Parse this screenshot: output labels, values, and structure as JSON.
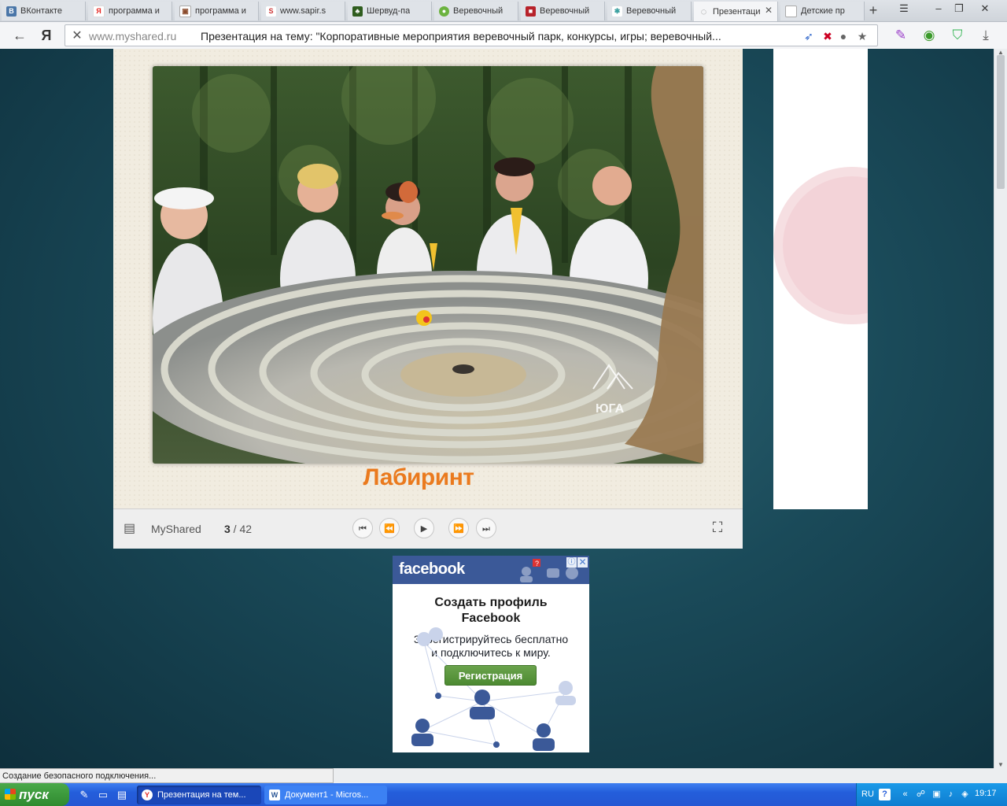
{
  "tabs": [
    {
      "label": "ВКонтакте",
      "icon": "vk-icon",
      "color": "#4a76a8",
      "glyph": "В"
    },
    {
      "label": "программа и",
      "icon": "yandex-icon",
      "color": "#e52620",
      "glyph": "Я"
    },
    {
      "label": "программа и",
      "icon": "image-icon",
      "color": "#8a4a2a",
      "glyph": "▣"
    },
    {
      "label": "www.sapir.s",
      "icon": "sapir-icon",
      "color": "#c33",
      "glyph": "S"
    },
    {
      "label": "Шервуд-па",
      "icon": "sherwood-icon",
      "color": "#2f5d1e",
      "glyph": "♣"
    },
    {
      "label": "Веревочный",
      "icon": "green-circle-icon",
      "color": "#6cb33f",
      "glyph": "●"
    },
    {
      "label": "Веревочный",
      "icon": "red-cube-icon",
      "color": "#b7222a",
      "glyph": "■"
    },
    {
      "label": "Веревочный",
      "icon": "snowflake-icon",
      "color": "#3aa0a0",
      "glyph": "✱"
    },
    {
      "label": "Презентаци",
      "icon": "loading-icon",
      "color": "#999",
      "glyph": "◌",
      "active": true
    },
    {
      "label": "Детские пр",
      "icon": "page-icon",
      "color": "#aaa",
      "glyph": "▯"
    }
  ],
  "address": {
    "domain": "www.myshared.ru",
    "title": "Презентация на тему: \"Корпоративные мероприятия веревочный парк, конкурсы, игры; веревочный..."
  },
  "slide": {
    "title": "Лабиринт",
    "badge_text": "ЮГА"
  },
  "controls": {
    "brand": "MyShared",
    "current_page": "3",
    "separator": " / ",
    "total_pages": "42"
  },
  "fb_ad": {
    "logo": "facebook",
    "headline_line1": "Создать профиль",
    "headline_line2": "Facebook",
    "sub_line1": "Зарегистрируйтесь бесплатно",
    "sub_line2": "и подключитесь к миру.",
    "button": "Регистрация",
    "notif_count": "?"
  },
  "status_text": "Создание безопасного подключения...",
  "taskbar": {
    "start_label": "пуск",
    "tasks": [
      {
        "label": "Презентация на тем...",
        "glyph": "Y",
        "active": true
      },
      {
        "label": "Документ1 - Micros...",
        "glyph": "W",
        "active": false
      }
    ],
    "lang": "RU",
    "clock": "19:17"
  },
  "colors": {
    "accent_orange": "#ea7a1e",
    "facebook_blue": "#3b5998",
    "xp_taskbar": "#245edb"
  }
}
